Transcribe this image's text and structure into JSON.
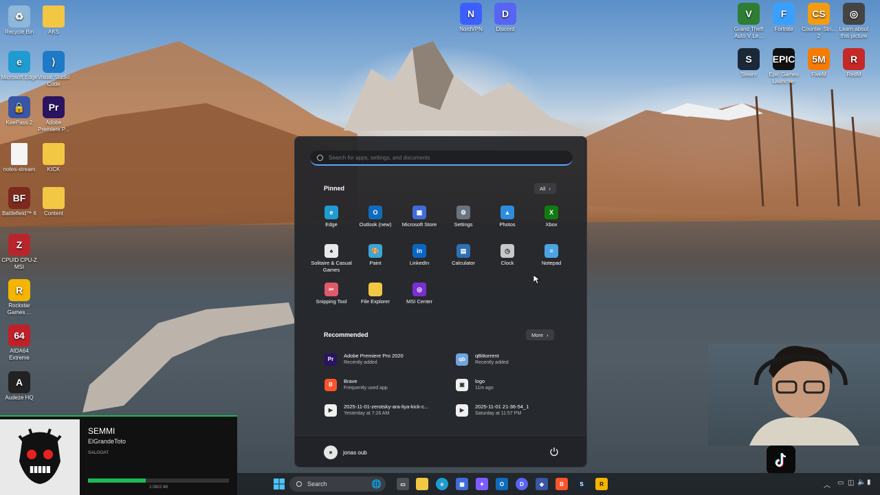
{
  "desktop": {
    "left_icons": [
      {
        "label": "Recycle Bin",
        "icon": "recycle-bin-icon",
        "color": "#8fb7d8",
        "glyph": "♻"
      },
      {
        "label": "AKS",
        "icon": "folder-icon",
        "color": "#f2c744",
        "glyph": ""
      },
      {
        "label": "Microsoft Edge",
        "icon": "edge-icon",
        "color": "#1f9bd1",
        "glyph": "e"
      },
      {
        "label": "Visual Studio Code",
        "icon": "vscode-icon",
        "color": "#1e7ac6",
        "glyph": "⟩"
      },
      {
        "label": "KeePass 2",
        "icon": "keepass-icon",
        "color": "#3a55a4",
        "glyph": "🔒"
      },
      {
        "label": "Adobe Premiere P...",
        "icon": "premiere-icon",
        "color": "#2a1360",
        "glyph": "Pr"
      },
      {
        "label": "notes-stream",
        "icon": "text-file-icon",
        "color": "#f5f5f5",
        "glyph": ""
      },
      {
        "label": "KICK",
        "icon": "folder-icon",
        "color": "#f2c744",
        "glyph": ""
      },
      {
        "label": "Battlefield™ 6",
        "icon": "battlefield-icon",
        "color": "#7d2a1e",
        "glyph": "BF"
      },
      {
        "label": "Content",
        "icon": "folder-icon",
        "color": "#f2c744",
        "glyph": ""
      },
      {
        "label": "CPUID CPU-Z MSI",
        "icon": "cpuz-icon",
        "color": "#b9252c",
        "glyph": "Z"
      },
      {
        "label": "Rockstar Games ...",
        "icon": "rockstar-icon",
        "color": "#f4b400",
        "glyph": "R"
      },
      {
        "label": "AIDA64 Extreme",
        "icon": "aida64-icon",
        "color": "#c0202a",
        "glyph": "64"
      },
      {
        "label": "Audeze HQ",
        "icon": "audeze-icon",
        "color": "#222",
        "glyph": "A"
      }
    ],
    "top_icons": [
      {
        "label": "NordVPN",
        "icon": "nordvpn-icon",
        "color": "#3e5fff",
        "glyph": "N"
      },
      {
        "label": "Discord",
        "icon": "discord-icon",
        "color": "#5865f2",
        "glyph": "D"
      }
    ],
    "right_icons": [
      {
        "label": "Grand Theft Auto V Le...",
        "icon": "gta-icon",
        "color": "#2e7d32",
        "glyph": "V"
      },
      {
        "label": "Fortnite",
        "icon": "fortnite-icon",
        "color": "#3aa0ff",
        "glyph": "F"
      },
      {
        "label": "Counter-Stri... 2",
        "icon": "counter-strike-icon",
        "color": "#f39c12",
        "glyph": "CS"
      },
      {
        "label": "Learn about this picture",
        "icon": "camera-icon",
        "color": "#444",
        "glyph": "◎"
      },
      {
        "label": "Steam",
        "icon": "steam-icon",
        "color": "#1b2838",
        "glyph": "S"
      },
      {
        "label": "Epic Games Launcher",
        "icon": "epic-games-icon",
        "color": "#111",
        "glyph": "EPIC"
      },
      {
        "label": "FiveM",
        "icon": "fivem-icon",
        "color": "#f57c00",
        "glyph": "5M"
      },
      {
        "label": "RedM",
        "icon": "redm-icon",
        "color": "#c62828",
        "glyph": "R"
      }
    ]
  },
  "start_menu": {
    "search_placeholder": "Search for apps, settings, and documents",
    "pinned_title": "Pinned",
    "all_label": "All",
    "pinned": [
      {
        "label": "Edge",
        "icon": "edge-icon",
        "color": "#1f9bd1",
        "glyph": "e"
      },
      {
        "label": "Outlook (new)",
        "icon": "outlook-icon",
        "color": "#0f6cbd",
        "glyph": "O"
      },
      {
        "label": "Microsoft Store",
        "icon": "store-icon",
        "color": "#3f6cd8",
        "glyph": "▦"
      },
      {
        "label": "Settings",
        "icon": "settings-gear-icon",
        "color": "#6a7480",
        "glyph": "⚙"
      },
      {
        "label": "Photos",
        "icon": "photos-icon",
        "color": "#2d8be0",
        "glyph": "▲"
      },
      {
        "label": "Xbox",
        "icon": "xbox-icon",
        "color": "#107c10",
        "glyph": "X"
      },
      {
        "label": "Solitaire & Casual Games",
        "icon": "solitaire-icon",
        "color": "#e8e8e8",
        "glyph": "♠"
      },
      {
        "label": "Paint",
        "icon": "paint-icon",
        "color": "#3aa5d8",
        "glyph": "🎨"
      },
      {
        "label": "LinkedIn",
        "icon": "linkedin-icon",
        "color": "#0a66c2",
        "glyph": "in"
      },
      {
        "label": "Calculator",
        "icon": "calculator-icon",
        "color": "#2e6fb5",
        "glyph": "▤"
      },
      {
        "label": "Clock",
        "icon": "clock-icon",
        "color": "#c8c8c8",
        "glyph": "◷"
      },
      {
        "label": "Notepad",
        "icon": "notepad-icon",
        "color": "#4ba3e3",
        "glyph": "≡"
      },
      {
        "label": "Snipping Tool",
        "icon": "snipping-tool-icon",
        "color": "#e05a6a",
        "glyph": "✂"
      },
      {
        "label": "File Explorer",
        "icon": "file-explorer-icon",
        "color": "#f2c744",
        "glyph": ""
      },
      {
        "label": "MSI Center",
        "icon": "msi-center-icon",
        "color": "#7a2fd0",
        "glyph": "◎"
      }
    ],
    "recommended_title": "Recommended",
    "more_label": "More",
    "recommended": [
      {
        "title": "Adobe Premiere Pro 2020",
        "subtitle": "Recently added",
        "icon": "premiere-icon",
        "color": "#2a1360",
        "glyph": "Pr"
      },
      {
        "title": "qBittorrent",
        "subtitle": "Recently added",
        "icon": "qbittorrent-icon",
        "color": "#6fa3e0",
        "glyph": "qb"
      },
      {
        "title": "Brave",
        "subtitle": "Frequently used app",
        "icon": "brave-icon",
        "color": "#fb542b",
        "glyph": "B"
      },
      {
        "title": "logo",
        "subtitle": "11m ago",
        "icon": "image-file-icon",
        "color": "#f0f0f0",
        "glyph": "▣"
      },
      {
        "title": "2025-11-01-zerotsky-ara-liya-kick-c...",
        "subtitle": "Yesterday at 7:26 AM",
        "icon": "video-file-icon",
        "color": "#f0f0f0",
        "glyph": "▶"
      },
      {
        "title": "2025-11-01 21-36-54_1",
        "subtitle": "Saturday at 11:57 PM",
        "icon": "video-file-icon",
        "color": "#f0f0f0",
        "glyph": "▶"
      }
    ],
    "user_name": "jonas oub"
  },
  "music_player": {
    "track": "SEMMI",
    "artist": "ElGrandeToto",
    "album": "SALGOAT",
    "time": "1:08/2:48",
    "progress": 0.41,
    "accent": "#1db954"
  },
  "taskbar": {
    "search_label": "Search"
  }
}
